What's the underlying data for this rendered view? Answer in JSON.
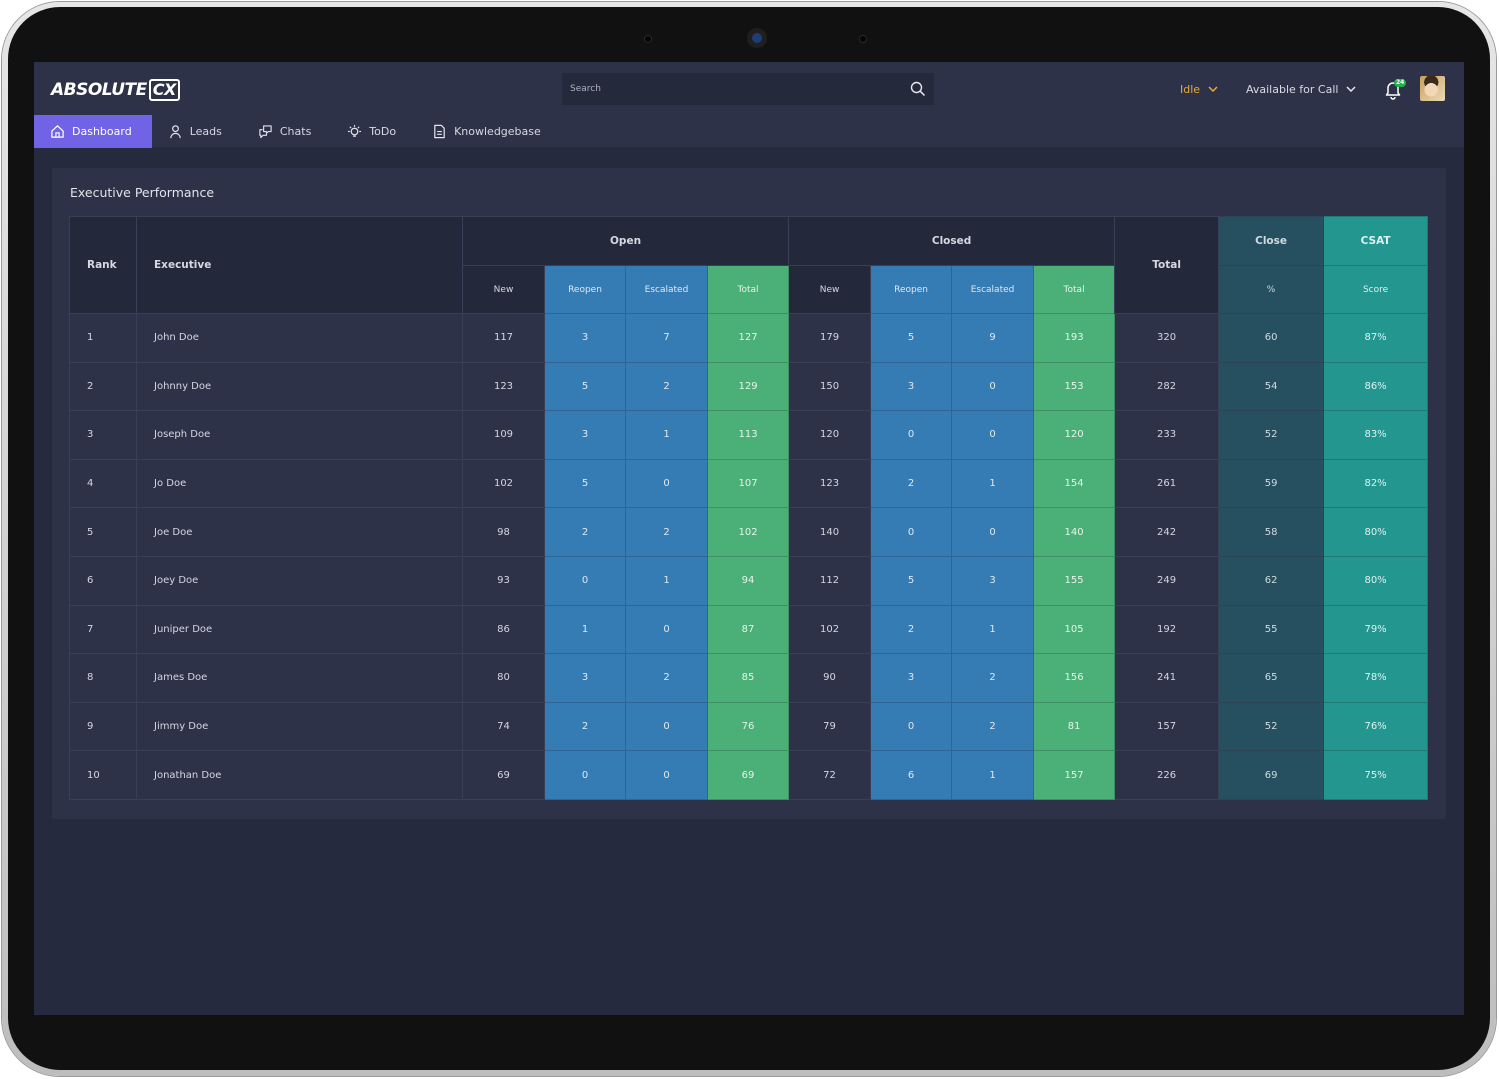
{
  "app": {
    "logo_text": "ABSOLUTE",
    "logo_badge": "CX"
  },
  "header": {
    "search_placeholder": "Search",
    "status_label": "Idle",
    "availability_label": "Available for Call",
    "notification_count": "24",
    "colors": {
      "status_idle": "#e9a92e",
      "accent": "#7163e6",
      "badge": "#23b04a"
    }
  },
  "nav": {
    "items": [
      {
        "label": "Dashboard",
        "icon": "home-icon",
        "active": true
      },
      {
        "label": "Leads",
        "icon": "user-icon",
        "active": false
      },
      {
        "label": "Chats",
        "icon": "chat-icon",
        "active": false
      },
      {
        "label": "ToDo",
        "icon": "lightbulb-icon",
        "active": false
      },
      {
        "label": "Knowledgebase",
        "icon": "document-icon",
        "active": false
      }
    ]
  },
  "card": {
    "title": "Executive Performance"
  },
  "table": {
    "headers": {
      "rank": "Rank",
      "executive": "Executive",
      "open": "Open",
      "closed": "Closed",
      "total": "Total",
      "close": "Close",
      "csat": "CSAT",
      "sub_new": "New",
      "sub_reopen": "Reopen",
      "sub_escalated": "Escalated",
      "sub_total": "Total",
      "sub_percent": "%",
      "sub_score": "Score"
    },
    "rows": [
      {
        "rank": "1",
        "executive": "John Doe",
        "open_new": "117",
        "open_reopen": "3",
        "open_escalated": "7",
        "open_total": "127",
        "closed_new": "179",
        "closed_reopen": "5",
        "closed_escalated": "9",
        "closed_total": "193",
        "total": "320",
        "close_pct": "60",
        "csat": "87%"
      },
      {
        "rank": "2",
        "executive": "Johnny Doe",
        "open_new": "123",
        "open_reopen": "5",
        "open_escalated": "2",
        "open_total": "129",
        "closed_new": "150",
        "closed_reopen": "3",
        "closed_escalated": "0",
        "closed_total": "153",
        "total": "282",
        "close_pct": "54",
        "csat": "86%"
      },
      {
        "rank": "3",
        "executive": "Joseph Doe",
        "open_new": "109",
        "open_reopen": "3",
        "open_escalated": "1",
        "open_total": "113",
        "closed_new": "120",
        "closed_reopen": "0",
        "closed_escalated": "0",
        "closed_total": "120",
        "total": "233",
        "close_pct": "52",
        "csat": "83%"
      },
      {
        "rank": "4",
        "executive": "Jo Doe",
        "open_new": "102",
        "open_reopen": "5",
        "open_escalated": "0",
        "open_total": "107",
        "closed_new": "123",
        "closed_reopen": "2",
        "closed_escalated": "1",
        "closed_total": "154",
        "total": "261",
        "close_pct": "59",
        "csat": "82%"
      },
      {
        "rank": "5",
        "executive": "Joe Doe",
        "open_new": "98",
        "open_reopen": "2",
        "open_escalated": "2",
        "open_total": "102",
        "closed_new": "140",
        "closed_reopen": "0",
        "closed_escalated": "0",
        "closed_total": "140",
        "total": "242",
        "close_pct": "58",
        "csat": "80%"
      },
      {
        "rank": "6",
        "executive": "Joey Doe",
        "open_new": "93",
        "open_reopen": "0",
        "open_escalated": "1",
        "open_total": "94",
        "closed_new": "112",
        "closed_reopen": "5",
        "closed_escalated": "3",
        "closed_total": "155",
        "total": "249",
        "close_pct": "62",
        "csat": "80%"
      },
      {
        "rank": "7",
        "executive": "Juniper Doe",
        "open_new": "86",
        "open_reopen": "1",
        "open_escalated": "0",
        "open_total": "87",
        "closed_new": "102",
        "closed_reopen": "2",
        "closed_escalated": "1",
        "closed_total": "105",
        "total": "192",
        "close_pct": "55",
        "csat": "79%"
      },
      {
        "rank": "8",
        "executive": "James Doe",
        "open_new": "80",
        "open_reopen": "3",
        "open_escalated": "2",
        "open_total": "85",
        "closed_new": "90",
        "closed_reopen": "3",
        "closed_escalated": "2",
        "closed_total": "156",
        "total": "241",
        "close_pct": "65",
        "csat": "78%"
      },
      {
        "rank": "9",
        "executive": "Jimmy Doe",
        "open_new": "74",
        "open_reopen": "2",
        "open_escalated": "0",
        "open_total": "76",
        "closed_new": "79",
        "closed_reopen": "0",
        "closed_escalated": "2",
        "closed_total": "81",
        "total": "157",
        "close_pct": "52",
        "csat": "76%"
      },
      {
        "rank": "10",
        "executive": "Jonathan Doe",
        "open_new": "69",
        "open_reopen": "0",
        "open_escalated": "0",
        "open_total": "69",
        "closed_new": "72",
        "closed_reopen": "6",
        "closed_escalated": "1",
        "closed_total": "157",
        "total": "226",
        "close_pct": "69",
        "csat": "75%"
      }
    ],
    "colors": {
      "reopen_escalated": "#357cb5",
      "totals": "#4baf78",
      "close_pct": "#26505f",
      "csat": "#22968f"
    }
  }
}
